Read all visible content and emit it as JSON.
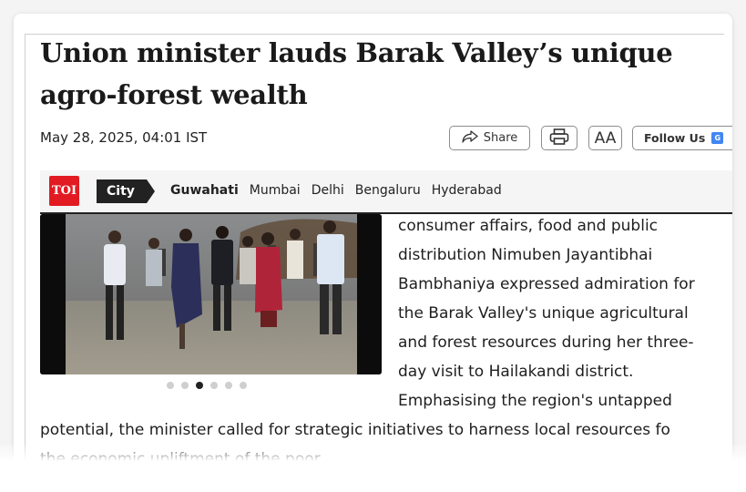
{
  "article": {
    "headline": "Union minister lauds Barak Valley’s unique agro-forest wealth",
    "dateline": "May 28, 2025, 04:01 IST"
  },
  "actions": {
    "share_label": "Share",
    "aa_label": "AA",
    "follow_label": "Follow Us",
    "icons": [
      "share-icon",
      "printer-icon",
      "google-news-icon"
    ]
  },
  "nav": {
    "logo_text": "TOI",
    "city_label": "City",
    "cities": [
      "Guwahati",
      "Mumbai",
      "Delhi",
      "Bengaluru",
      "Hyderabad"
    ],
    "active_city": "Guwahati"
  },
  "carousel": {
    "slide_count": 6,
    "active_index": 2
  },
  "body": {
    "right_lines": [
      "consumer affairs, food and public",
      "distribution Nimuben Jayantibhai",
      "Bambhaniya expressed admiration for",
      "the Barak Valley's unique agricultural",
      "and forest resources during her three-",
      "day visit to Hailakandi district.",
      "Emphasising the region's untapped"
    ],
    "full_lines": [
      "potential, the minister called for strategic initiatives to harness local resources fo",
      "the economic upliftment of the poor."
    ]
  },
  "colors": {
    "brand_red": "#e21b22",
    "chip_dark": "#222222"
  }
}
